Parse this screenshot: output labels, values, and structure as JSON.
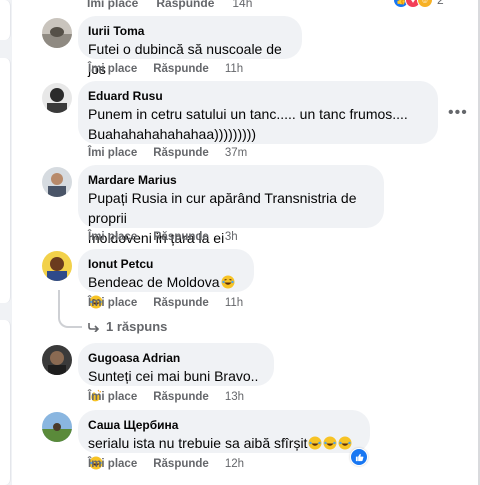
{
  "top_row": {
    "like_label": "Îmi place",
    "reply_label": "Răspunde",
    "time": "14h",
    "reaction_count": "2"
  },
  "comments": [
    {
      "author": "Iurii Toma",
      "lines": [
        "Futei o dubincă să nuscoale de jos"
      ],
      "like_label": "Îmi place",
      "reply_label": "Răspunde",
      "time": "11h"
    },
    {
      "author": "Eduard Rusu",
      "lines": [
        "Punem in cetru satului un tanc..... un tanc frumos....",
        "Buahahahahahahaa)))))))))"
      ],
      "like_label": "Îmi place",
      "reply_label": "Răspunde",
      "time": "37m"
    },
    {
      "author": "Mardare Marius",
      "lines": [
        "Pupați Rusia in cur apărând Transnistria de proprii",
        "moldoveni in țara la ei"
      ],
      "like_label": "Îmi place",
      "reply_label": "Răspunde",
      "time": "3h"
    },
    {
      "author": "Ionut Petcu",
      "lines": [
        "Bendeac de Moldova"
      ],
      "like_label": "Îmi place",
      "reply_label": "Răspunde",
      "time": "11h"
    },
    {
      "author": "Gugoasa Adrian",
      "lines": [
        "Sunteți cei mai buni Bravo.."
      ],
      "like_label": "Îmi place",
      "reply_label": "Răspunde",
      "time": "13h"
    },
    {
      "author": "Саша Щербина",
      "lines": [
        "serialu ista nu trebuie sa aibă sfîrșit"
      ],
      "like_label": "Îmi place",
      "reply_label": "Răspunde",
      "time": "12h"
    }
  ],
  "replies_link": "1 răspuns",
  "icons": {
    "more": "more-options-icon",
    "reply_arrow": "reply-arrow-icon",
    "like_badge": "like-thumb-icon",
    "laugh_emoji": "laughing-emoji-icon",
    "clap_emoji": "clapping-hands-icon"
  },
  "colors": {
    "bubble": "#f0f2f5",
    "meta_text": "#65676b",
    "like_blue": "#1877f2"
  }
}
